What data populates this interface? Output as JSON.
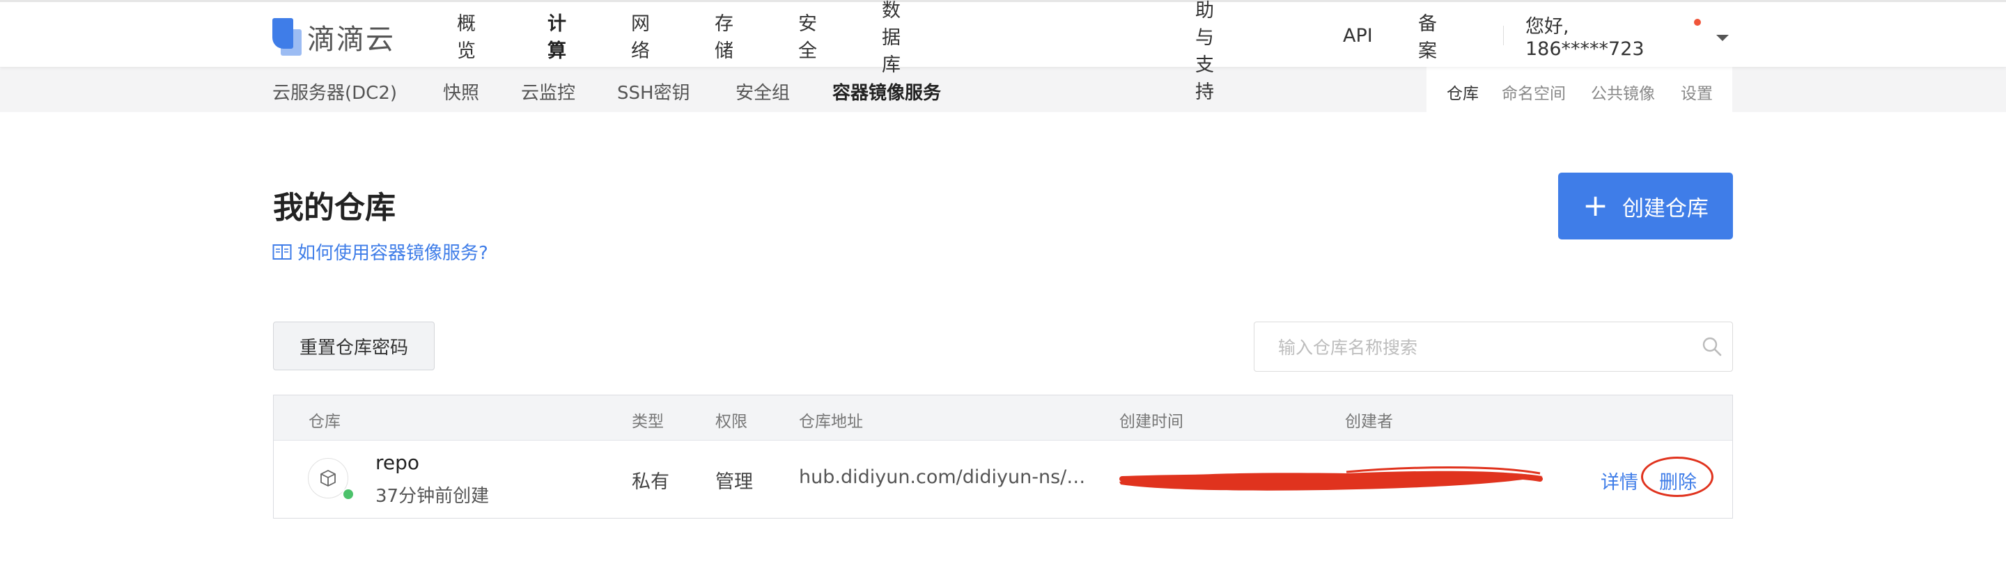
{
  "brand": {
    "name": "滴滴云"
  },
  "topnav": {
    "left": [
      "概览",
      "计算",
      "网络",
      "存储",
      "安全",
      "数据库"
    ],
    "right": [
      "帮助与支持",
      "API",
      "备案"
    ],
    "user": "您好, 186*****723"
  },
  "subnav": {
    "items": [
      "云服务器(DC2)",
      "快照",
      "云监控",
      "SSH密钥",
      "安全组",
      "容器镜像服务"
    ],
    "right": [
      "仓库",
      "命名空间",
      "公共镜像",
      "设置"
    ]
  },
  "main": {
    "title": "我的仓库",
    "help_link": "如何使用容器镜像服务?",
    "create_button": "创建仓库",
    "reset_button": "重置仓库密码",
    "search_placeholder": "输入仓库名称搜索"
  },
  "table": {
    "columns": [
      "仓库",
      "类型",
      "权限",
      "仓库地址",
      "创建时间",
      "创建者"
    ],
    "rows": [
      {
        "name": "repo",
        "subtitle": "37分钟前创建",
        "type": "私有",
        "permission": "管理",
        "address": "hub.didiyun.com/didiyun-ns/…",
        "actions": [
          "详情",
          "删除"
        ]
      }
    ]
  },
  "colors": {
    "accent": "#3f7de8",
    "redaction": "#e0331e",
    "status_ok": "#4cc26b"
  }
}
